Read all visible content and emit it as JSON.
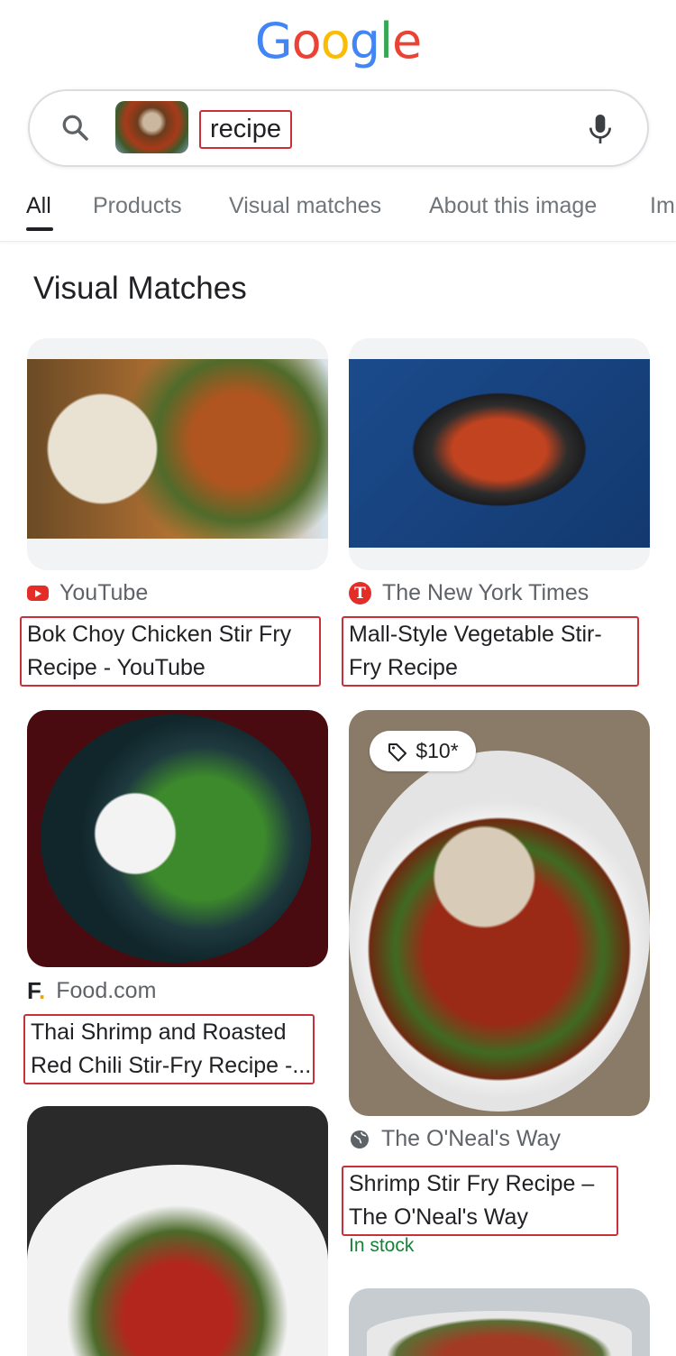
{
  "header": {
    "logo": "Google",
    "query": "recipe",
    "icons": [
      "search-icon",
      "image-thumbnail",
      "mic-icon"
    ]
  },
  "tabs": [
    {
      "label": "All",
      "active": true
    },
    {
      "label": "Products"
    },
    {
      "label": "Visual matches"
    },
    {
      "label": "About this image"
    },
    {
      "label": "Im"
    }
  ],
  "section_title": "Visual Matches",
  "results": [
    {
      "source": "YouTube",
      "title_lines": [
        "Bok Choy Chicken Stir Fry",
        "Recipe - YouTube"
      ],
      "source_icon": "youtube-icon"
    },
    {
      "source": "The New York Times",
      "title_lines": [
        "Mall-Style Vegetable Stir-",
        "Fry Recipe"
      ],
      "source_icon": "nyt-icon"
    },
    {
      "source": "Food.com",
      "title_lines": [
        "Thai Shrimp and Roasted",
        "Red Chili Stir-Fry Recipe -..."
      ],
      "source_icon": "food-com-icon"
    },
    {
      "source": "The O'Neal's Way",
      "title_lines": [
        "Shrimp Stir Fry Recipe –",
        "The O'Neal's Way"
      ],
      "source_icon": "globe-icon",
      "price": "$10*",
      "availability": "In stock"
    }
  ],
  "colors": {
    "accent_box": "#c8303a",
    "in_stock": "#188038"
  }
}
